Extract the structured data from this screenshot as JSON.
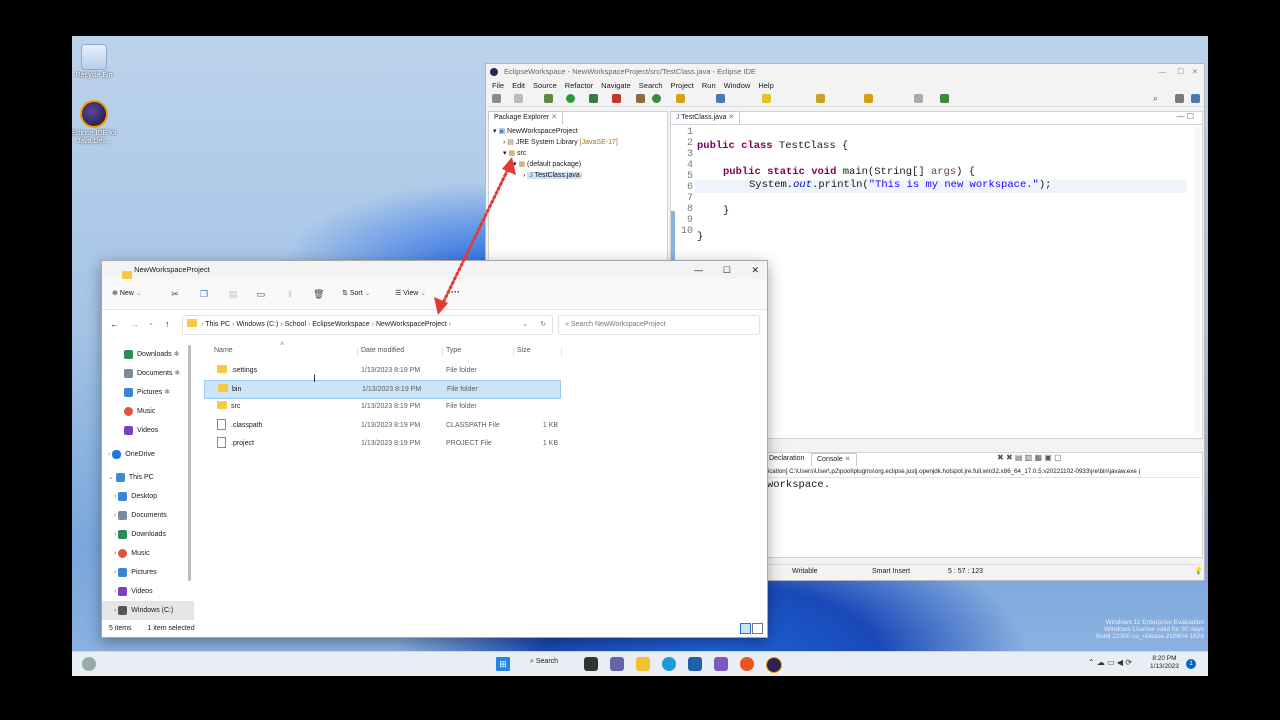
{
  "desktop": {
    "icons": [
      {
        "label": "Recycle Bin"
      },
      {
        "label": "Eclipse IDE for Java Dev..."
      }
    ],
    "watermark": [
      "Windows 11 Enterprise Evaluation",
      "Windows License valid for 90 days",
      "Build 22000.co_release.210604-1628"
    ]
  },
  "eclipse": {
    "title": "EclipseWorkspace - NewWorkspaceProject/src/TestClass.java - Eclipse IDE",
    "menu": [
      "File",
      "Edit",
      "Source",
      "Refactor",
      "Navigate",
      "Search",
      "Project",
      "Run",
      "Window",
      "Help"
    ],
    "package_explorer": {
      "tab": "Package Explorer",
      "tree": [
        "NewWorkspaceProject",
        "JRE System Library",
        "[JavaSE-17]",
        "src",
        "(default package)",
        "TestClass.java"
      ]
    },
    "editor": {
      "tab": "TestClass.java",
      "line_numbers": [
        "1",
        "2",
        "3",
        "4",
        "5",
        "6",
        "7",
        "8",
        "9",
        "10"
      ],
      "code": {
        "l2_kw": "public class",
        "l2_name": " TestClass {",
        "l4_kw": "public static void",
        "l4_rest": " main(String[] ",
        "l4_args": "args",
        "l4_end": ") {",
        "l5_a": "System.",
        "l5_out": "out",
        "l5_b": ".println(",
        "l5_str": "\"This is my new workspace.\"",
        "l5_end": ");",
        "l7": "}",
        "l9": "}"
      }
    },
    "console": {
      "tabs": [
        "Declaration",
        "Console"
      ],
      "path": "plication] C:\\Users\\User\\.p2\\pool\\plugins\\org.eclipse.justj.openjdk.hotspot.jre.full.win32.x86_64_17.0.5.v20221102-0933\\jre\\bin\\javaw.exe  (",
      "output": "workspace."
    },
    "status": {
      "writable": "Writable",
      "insert": "Smart Insert",
      "position": "5 : 57 : 123"
    }
  },
  "explorer": {
    "title": "NewWorkspaceProject",
    "toolbar": {
      "new": "New",
      "sort": "Sort",
      "view": "View",
      "more": "···"
    },
    "breadcrumb": [
      "This PC",
      "Windows (C:)",
      "School",
      "EclipseWorkspace",
      "NewWorkspaceProject"
    ],
    "search_placeholder": "Search NewWorkspaceProject",
    "nav": {
      "quick": [
        "Downloads",
        "Documents",
        "Pictures",
        "Music",
        "Videos"
      ],
      "onedrive": "OneDrive",
      "this_pc": "This PC",
      "pc_items": [
        "Desktop",
        "Documents",
        "Downloads",
        "Music",
        "Pictures",
        "Videos",
        "Windows (C:)"
      ]
    },
    "columns": [
      "Name",
      "Date modified",
      "Type",
      "Size"
    ],
    "files": [
      {
        "name": ".settings",
        "date": "1/13/2023 8:19 PM",
        "type": "File folder",
        "size": "",
        "kind": "folder"
      },
      {
        "name": "bin",
        "date": "1/13/2023 8:19 PM",
        "type": "File folder",
        "size": "",
        "kind": "folder"
      },
      {
        "name": "src",
        "date": "1/13/2023 8:19 PM",
        "type": "File folder",
        "size": "",
        "kind": "folder"
      },
      {
        "name": ".classpath",
        "date": "1/13/2023 8:19 PM",
        "type": "CLASSPATH File",
        "size": "1 KB",
        "kind": "file"
      },
      {
        "name": ".project",
        "date": "1/13/2023 8:19 PM",
        "type": "PROJECT File",
        "size": "1 KB",
        "kind": "file"
      }
    ],
    "status": {
      "items": "5 items",
      "selected": "1 item selected"
    }
  },
  "taskbar": {
    "search": "Search",
    "time": "8:20 PM",
    "date": "1/13/2023",
    "notif": "1"
  },
  "colors": {
    "accent": "#0067c0",
    "selection": "#cce4f7",
    "arrow": "#e53935",
    "keyword": "#7f0055",
    "string": "#2a00ff"
  }
}
